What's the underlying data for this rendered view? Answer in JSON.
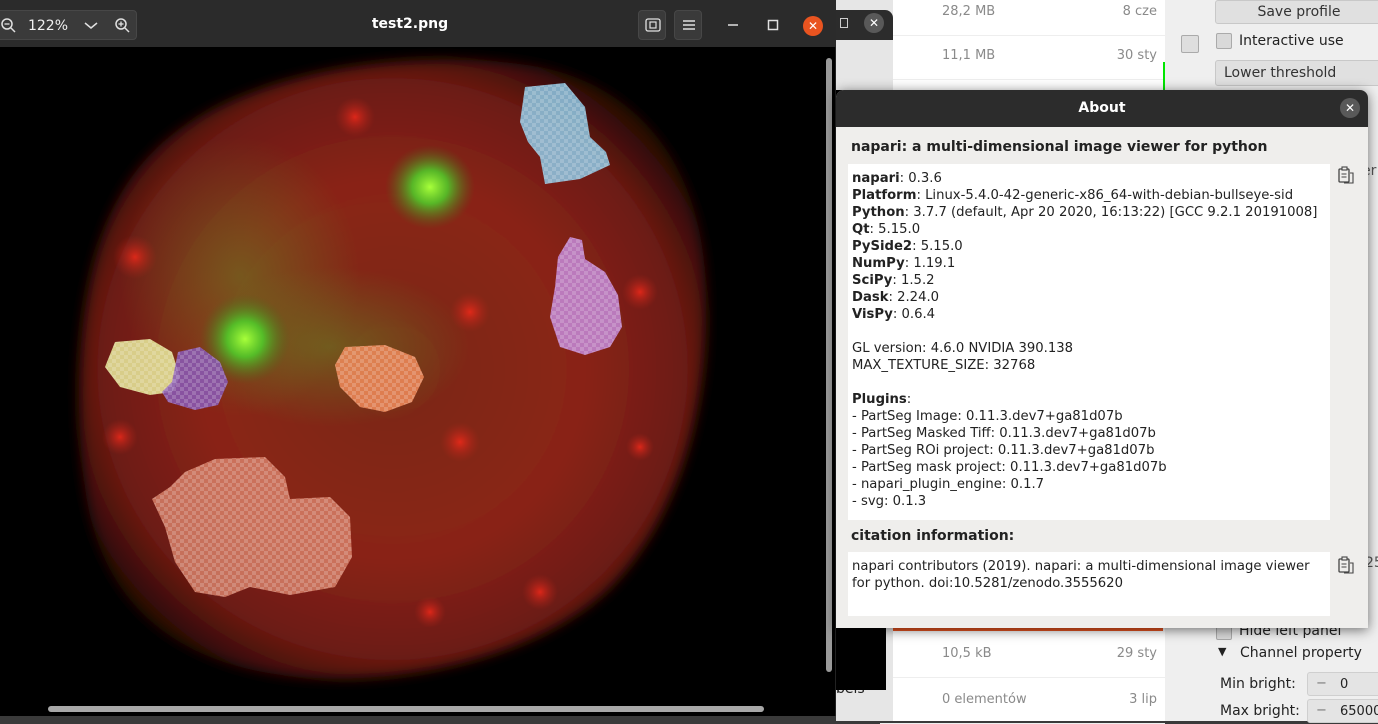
{
  "viewer": {
    "title": "test2.png",
    "zoom": "122%",
    "close_glyph": "✕"
  },
  "files": {
    "rows": [
      {
        "size": "28,2 MB",
        "date": "8 cze"
      },
      {
        "size": "11,1 MB",
        "date": "30 sty"
      },
      {
        "size": "10,5 kB",
        "date": "29 sty"
      },
      {
        "size": "0 elementów",
        "date": "3 lip"
      }
    ],
    "partial_label": "bels"
  },
  "partseg": {
    "save_profile": "Save profile",
    "interactive_use": "Interactive use",
    "lower_threshold": "Lower threshold",
    "hide_left_panel": "Hide left panel",
    "channel_property": "Channel property",
    "min_bright_label": "Min bright:",
    "min_bright_value": "0",
    "max_bright_label": "Max bright:",
    "max_bright_value": "65000",
    "spin_minus": "−",
    "partial_right": "er",
    "partial_right2": "25"
  },
  "about": {
    "title": "About",
    "header": "napari: a multi-dimensional image viewer for python",
    "info": [
      {
        "key": "napari",
        "value": ": 0.3.6"
      },
      {
        "key": "Platform",
        "value": ": Linux-5.4.0-42-generic-x86_64-with-debian-bullseye-sid"
      },
      {
        "key": "Python",
        "value": ": 3.7.7 (default, Apr 20 2020, 16:13:22) [GCC 9.2.1 20191008]"
      },
      {
        "key": "Qt",
        "value": ": 5.15.0"
      },
      {
        "key": "PySide2",
        "value": ": 5.15.0"
      },
      {
        "key": "NumPy",
        "value": ": 1.19.1"
      },
      {
        "key": "SciPy",
        "value": ": 1.5.2"
      },
      {
        "key": "Dask",
        "value": ": 2.24.0"
      },
      {
        "key": "VisPy",
        "value": ": 0.6.4"
      }
    ],
    "gl_version": "GL version: 4.6.0 NVIDIA 390.138",
    "max_texture": "MAX_TEXTURE_SIZE: 32768",
    "plugins_label": "Plugins",
    "plugins_colon": ":",
    "plugins": [
      "- PartSeg Image: 0.11.3.dev7+ga81d07b",
      "- PartSeg Masked Tiff: 0.11.3.dev7+ga81d07b",
      "- PartSeg ROi project: 0.11.3.dev7+ga81d07b",
      "- PartSeg mask project: 0.11.3.dev7+ga81d07b",
      "- napari_plugin_engine: 0.1.7",
      "- svg: 0.1.3"
    ],
    "citation_header": "citation information:",
    "citation_line1": "napari contributors (2019). napari: a multi-dimensional image viewer",
    "citation_line2": "for python. doi:10.5281/zenodo.3555620",
    "close_glyph": "✕"
  },
  "colors": {
    "accent": "#e95420",
    "titlebar": "#2c2c2c",
    "cell_red": "#b3241a",
    "mask_blue": "#8fc9e6",
    "mask_purple": "#c48ad9",
    "mask_yellow": "#e6e69a",
    "mask_violet": "#8a5ab8",
    "mask_orange": "#f08a5a",
    "mask_salmon": "#d9826a"
  }
}
